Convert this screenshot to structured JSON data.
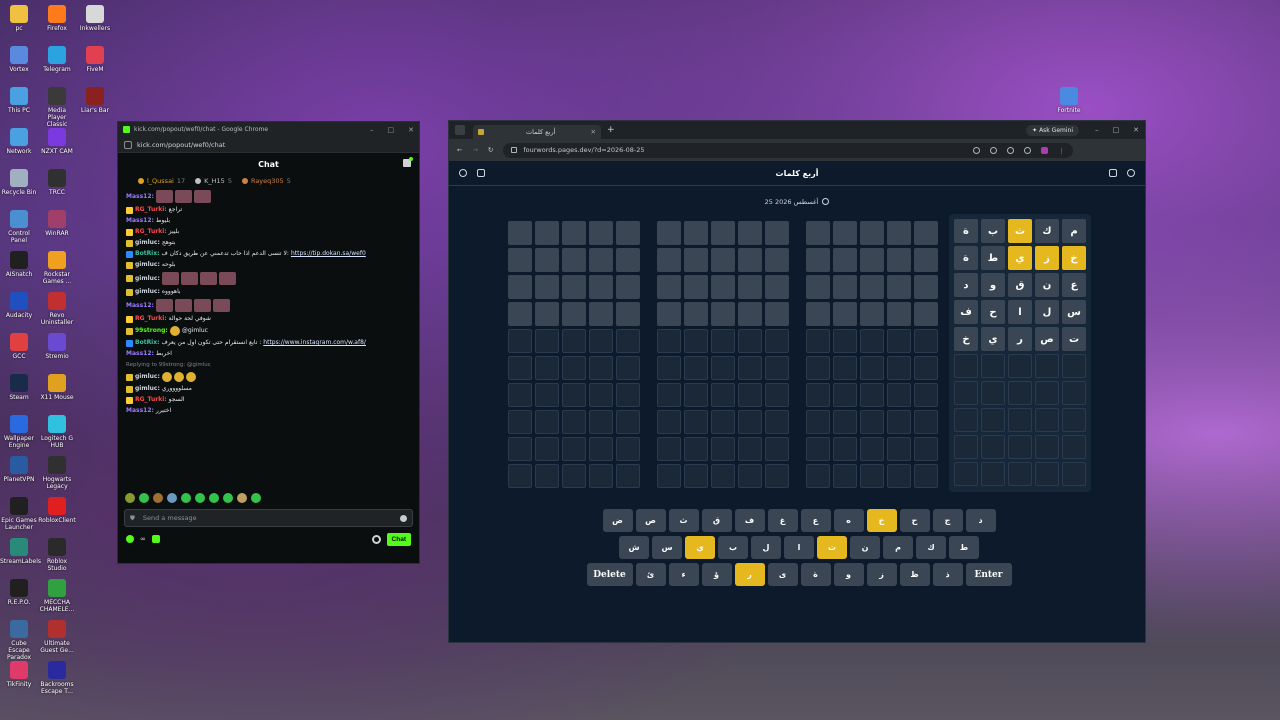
{
  "desktop": {
    "icons": [
      {
        "label": "pc",
        "color": "#f0c040"
      },
      {
        "label": "Firefox",
        "color": "#ff7a1a"
      },
      {
        "label": "Inkwellers",
        "color": "#d8d8d8"
      },
      {
        "label": "Vortex",
        "color": "#5a8ae0"
      },
      {
        "label": "Telegram",
        "color": "#2aa3e0"
      },
      {
        "label": "FiveM",
        "color": "#e04050"
      },
      {
        "label": "This PC",
        "color": "#4aa0e0"
      },
      {
        "label": "Media Player Classic",
        "color": "#3a3a3a"
      },
      {
        "label": "Liar's Bar",
        "color": "#8a2020"
      },
      {
        "label": "Network",
        "color": "#4aa0e0"
      },
      {
        "label": "NZXT CAM",
        "color": "#7a3ae0"
      },
      {
        "label": "Recycle Bin",
        "color": "#a0b0c0"
      },
      {
        "label": "TRCC",
        "color": "#303030"
      },
      {
        "label": "Control Panel",
        "color": "#4a90d0"
      },
      {
        "label": "WinRAR",
        "color": "#a0406a"
      },
      {
        "label": "AISnatch",
        "color": "#202020"
      },
      {
        "label": "Rockstar Games ...",
        "color": "#f0a020"
      },
      {
        "label": "Audacity",
        "color": "#2050c0"
      },
      {
        "label": "Revo Uninstaller",
        "color": "#c03030"
      },
      {
        "label": "GCC",
        "color": "#e04040"
      },
      {
        "label": "Stremio",
        "color": "#6a4ad0"
      },
      {
        "label": "Steam",
        "color": "#1a2a4a"
      },
      {
        "label": "X11 Mouse",
        "color": "#e0a020"
      },
      {
        "label": "Wallpaper Engine",
        "color": "#2a6ae0"
      },
      {
        "label": "Logitech G HUB",
        "color": "#30c0e0"
      },
      {
        "label": "PlanetVPN",
        "color": "#2a5aa0"
      },
      {
        "label": "Hogwarts Legacy",
        "color": "#303030"
      },
      {
        "label": "Epic Games Launcher",
        "color": "#202020"
      },
      {
        "label": "RobloxClient",
        "color": "#e02020"
      },
      {
        "label": "StreamLabels",
        "color": "#2a8a7a"
      },
      {
        "label": "Roblox Studio",
        "color": "#2a2a2a"
      },
      {
        "label": "R.E.P.O.",
        "color": "#202020"
      },
      {
        "label": "MECCHA CHAMELE...",
        "color": "#30a040"
      },
      {
        "label": "Cube Escape Paradox",
        "color": "#3a6aa0"
      },
      {
        "label": "Ultimate Guest Ge...",
        "color": "#b03030"
      },
      {
        "label": "TikFinity",
        "color": "#e03a6a"
      },
      {
        "label": "Backrooms Escape T...",
        "color": "#2a2aa0"
      }
    ],
    "right_icons": [
      {
        "label": "Fortnite",
        "color": "#4a8ae0"
      }
    ]
  },
  "chat_window": {
    "title": "kick.com/popout/wef0/chat - Google Chrome",
    "url": "kick.com/popout/wef0/chat",
    "header": "Chat",
    "top_gifters": [
      {
        "name": "l_Qussai",
        "count": "17",
        "color": "#e0a020"
      },
      {
        "name": "K_H15",
        "count": "5",
        "color": "#c0c0c0"
      },
      {
        "name": "Rayeq305",
        "count": "5",
        "color": "#d08040"
      }
    ],
    "messages": [
      {
        "user": "Mass12:",
        "color": "#9b7bff",
        "text": "",
        "emotes": 3
      },
      {
        "user": "RG_Turki:",
        "color": "#ff4a4a",
        "text": "تراجع",
        "emotes": 0
      },
      {
        "user": "Mass12:",
        "color": "#9b7bff",
        "text": "بليوط",
        "emotes": 0
      },
      {
        "user": "RG_Turki:",
        "color": "#ff4a4a",
        "text": "بلييز",
        "emotes": 0
      },
      {
        "user": "gimluc:",
        "color": "#cfd6de",
        "text": "بتوهج",
        "emotes": 0
      },
      {
        "user": "BotRix:",
        "color": "#3ac3a0",
        "text": "لا تنسى الدعم اذا حاب تدعمني عن طريق دكان ف:",
        "link": "https://tip.dokan.sa/wef0",
        "emotes": 0
      },
      {
        "user": "gimluc:",
        "color": "#cfd6de",
        "text": "بلوحه",
        "emotes": 0
      },
      {
        "user": "gimluc:",
        "color": "#cfd6de",
        "text": "",
        "emotes": 4
      },
      {
        "user": "gimluc:",
        "color": "#cfd6de",
        "text": "باهوووه",
        "emotes": 0
      },
      {
        "user": "Mass12:",
        "color": "#9b7bff",
        "text": "",
        "emotes": 4
      },
      {
        "user": "RG_Turki:",
        "color": "#ff4a4a",
        "text": "شوفي لحة حوالة",
        "emotes": 0
      },
      {
        "user": "99strong:",
        "color": "#53fc18",
        "text": "@gimluc",
        "emotes": 1
      },
      {
        "user": "BotRix:",
        "color": "#3ac3a0",
        "text": "تابع انستقرام حتى تكون اول من يعرف :",
        "link": "https://www.instagram.com/w.af8/",
        "emotes": 0
      },
      {
        "user": "Mass12:",
        "color": "#9b7bff",
        "text": "اخربط",
        "emotes": 0
      },
      {
        "reply": "Replying to 99strong: @gimluc",
        "user": "gimluc:",
        "color": "#cfd6de",
        "text": "",
        "emotes": 3
      },
      {
        "user": "gimluc:",
        "color": "#cfd6de",
        "text": "مسلووووري",
        "emotes": 0
      },
      {
        "user": "RG_Turki:",
        "color": "#ff4a4a",
        "text": "السجو",
        "emotes": 0
      },
      {
        "user": "Mass12:",
        "color": "#9b7bff",
        "text": "اختيرر",
        "emotes": 0
      }
    ],
    "input_placeholder": "Send a message",
    "send_label": "Chat"
  },
  "browser": {
    "tab_title": "أربع كلمات",
    "ask_gemini": "Ask Gemini",
    "url": "fourwords.pages.dev/?d=2026-08-25",
    "app_title": "أربع كلمات",
    "date_text": "25 أغسطس 2026",
    "active_board_rows": [
      [
        "م",
        "ك",
        "ث",
        "ب",
        "ة"
      ],
      [
        "خ",
        "ز",
        "ي",
        "ط",
        "ة"
      ],
      [
        "ع",
        "ن",
        "ق",
        "و",
        "د"
      ],
      [
        "س",
        "ل",
        "ا",
        "ح",
        "ف"
      ],
      [
        "ت",
        "ص",
        "ر",
        "ي",
        "خ"
      ]
    ],
    "active_board_yellow": [
      [
        0,
        2
      ],
      [
        1,
        0
      ],
      [
        1,
        1
      ],
      [
        1,
        2
      ]
    ],
    "keyboard": {
      "row1": [
        {
          "k": "ض",
          "y": false
        },
        {
          "k": "ص",
          "y": false
        },
        {
          "k": "ث",
          "y": false
        },
        {
          "k": "ق",
          "y": false
        },
        {
          "k": "ف",
          "y": false
        },
        {
          "k": "غ",
          "y": false
        },
        {
          "k": "ع",
          "y": false
        },
        {
          "k": "ه",
          "y": false
        },
        {
          "k": "خ",
          "y": true
        },
        {
          "k": "ح",
          "y": false
        },
        {
          "k": "ج",
          "y": false
        },
        {
          "k": "د",
          "y": false
        }
      ],
      "row2": [
        {
          "k": "ش",
          "y": false
        },
        {
          "k": "س",
          "y": false
        },
        {
          "k": "ي",
          "y": true
        },
        {
          "k": "ب",
          "y": false
        },
        {
          "k": "ل",
          "y": false
        },
        {
          "k": "ا",
          "y": false
        },
        {
          "k": "ت",
          "y": true
        },
        {
          "k": "ن",
          "y": false
        },
        {
          "k": "م",
          "y": false
        },
        {
          "k": "ك",
          "y": false
        },
        {
          "k": "ط",
          "y": false
        }
      ],
      "row3": [
        {
          "k": "Delete",
          "y": false,
          "wide": true
        },
        {
          "k": "ئ",
          "y": false
        },
        {
          "k": "ء",
          "y": false
        },
        {
          "k": "ؤ",
          "y": false
        },
        {
          "k": "ر",
          "y": true
        },
        {
          "k": "ى",
          "y": false
        },
        {
          "k": "ة",
          "y": false
        },
        {
          "k": "و",
          "y": false
        },
        {
          "k": "ز",
          "y": false
        },
        {
          "k": "ظ",
          "y": false
        },
        {
          "k": "ذ",
          "y": false
        },
        {
          "k": "Enter",
          "y": false,
          "wide": true
        }
      ]
    }
  },
  "colors": {
    "kick_green": "#53fc18",
    "tile_yellow": "#e6b820",
    "tile_gray": "#3a4654",
    "board_bg": "#0d1a2b"
  }
}
